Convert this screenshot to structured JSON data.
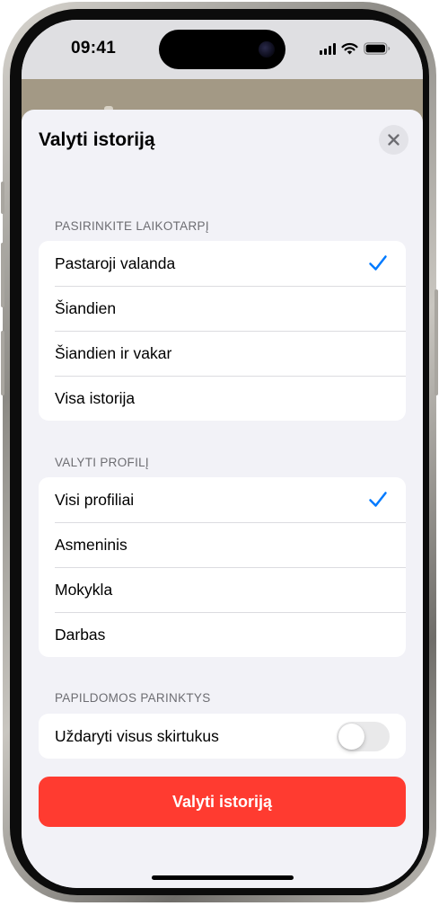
{
  "status_bar": {
    "time": "09:41"
  },
  "sheet": {
    "title": "Valyti istoriją",
    "close_icon": "xmark-icon"
  },
  "sections": {
    "timeframe": {
      "header": "PASIRINKITE LAIKOTARPĮ",
      "options": [
        {
          "label": "Pastaroji valanda",
          "selected": true
        },
        {
          "label": "Šiandien",
          "selected": false
        },
        {
          "label": "Šiandien ir vakar",
          "selected": false
        },
        {
          "label": "Visa istorija",
          "selected": false
        }
      ]
    },
    "profile": {
      "header": "VALYTI PROFILĮ",
      "options": [
        {
          "label": "Visi profiliai",
          "selected": true
        },
        {
          "label": "Asmeninis",
          "selected": false
        },
        {
          "label": "Mokykla",
          "selected": false
        },
        {
          "label": "Darbas",
          "selected": false
        }
      ]
    },
    "additional": {
      "header": "PAPILDOMOS PARINKTYS",
      "close_tabs_label": "Uždaryti visus skirtukus",
      "close_tabs_on": false
    }
  },
  "primary_button": {
    "label": "Valyti istoriją"
  },
  "colors": {
    "accent": "#007aff",
    "destructive": "#ff3b30",
    "background": "#f2f2f7"
  }
}
